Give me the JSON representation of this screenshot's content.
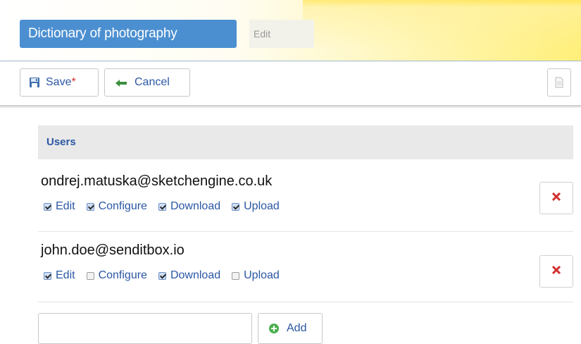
{
  "header": {
    "title": "Dictionary of photography",
    "mode": "Edit"
  },
  "toolbar": {
    "save_label": "Save",
    "save_modified_marker": "*",
    "cancel_label": "Cancel"
  },
  "users_section": {
    "heading": "Users",
    "users": [
      {
        "email": "ondrej.matuska@sketchengine.co.uk",
        "permissions": [
          {
            "label": "Edit",
            "checked": true
          },
          {
            "label": "Configure",
            "checked": true
          },
          {
            "label": "Download",
            "checked": true
          },
          {
            "label": "Upload",
            "checked": true
          }
        ]
      },
      {
        "email": "john.doe@senditbox.io",
        "permissions": [
          {
            "label": "Edit",
            "checked": true
          },
          {
            "label": "Configure",
            "checked": false
          },
          {
            "label": "Download",
            "checked": true
          },
          {
            "label": "Upload",
            "checked": false
          }
        ]
      }
    ],
    "add_input": {
      "value": "",
      "placeholder": ""
    },
    "add_label": "Add"
  },
  "icons": {
    "save": "floppy-disk-icon",
    "cancel": "arrow-left-icon",
    "document": "document-icon",
    "delete": "red-x-icon",
    "add": "green-plus-circle-icon"
  },
  "colors": {
    "accent": "#4b8fd1",
    "link": "#2a57a3",
    "danger": "#d3302f",
    "add_green": "#4caf50"
  }
}
